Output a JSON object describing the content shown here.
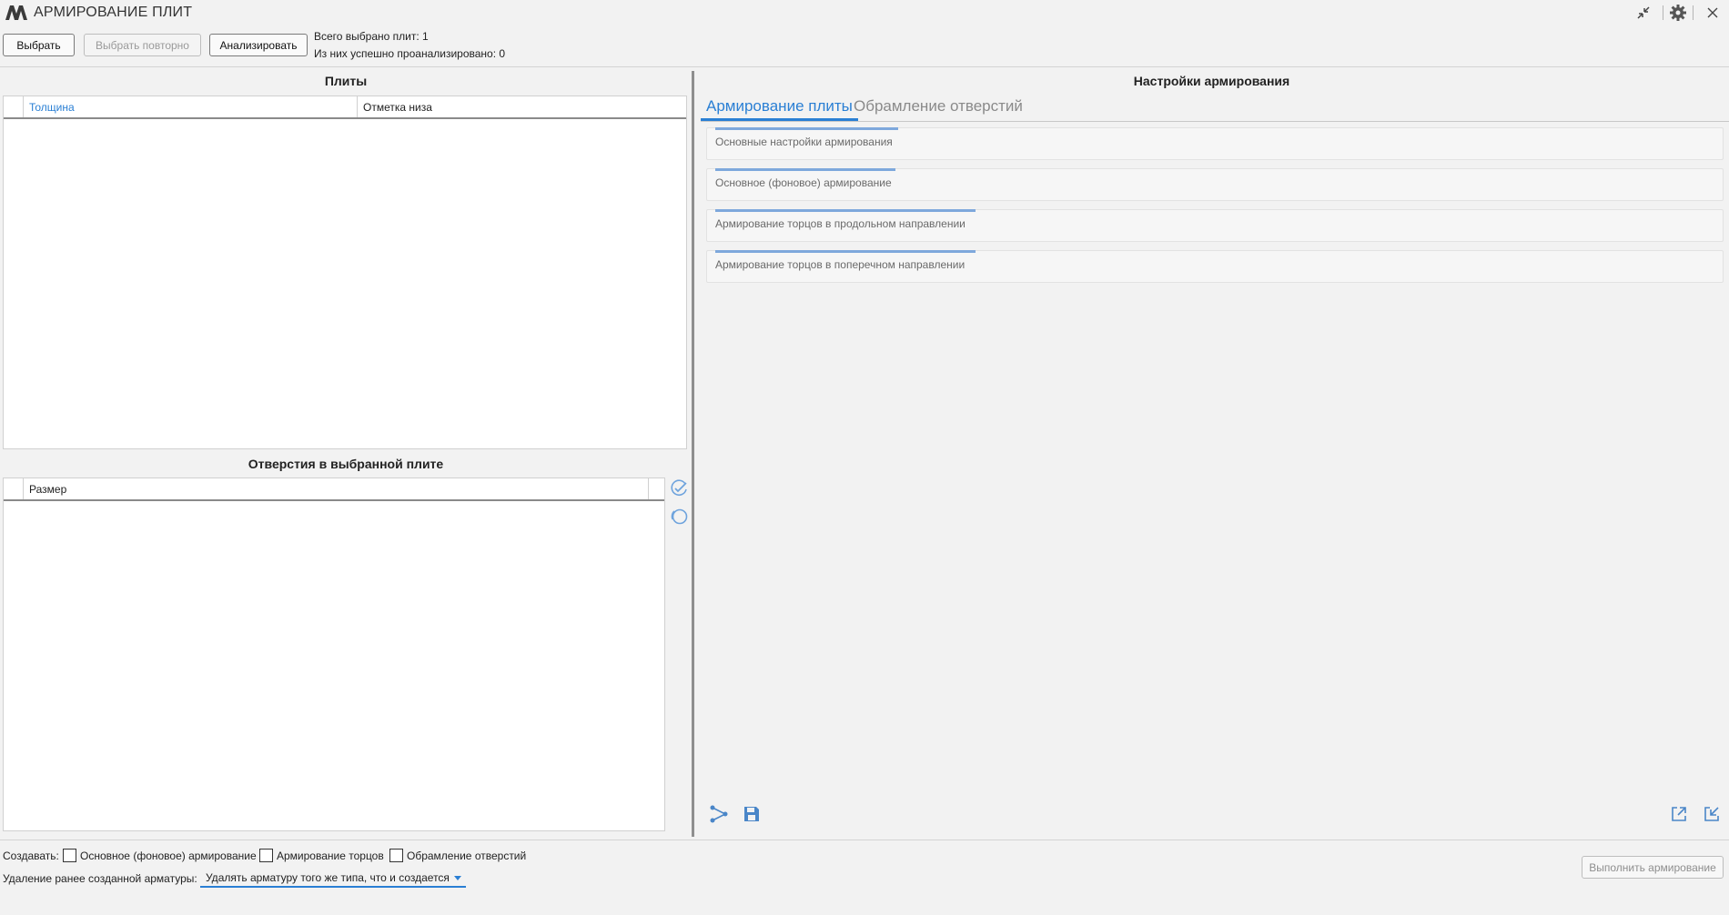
{
  "app": {
    "title": "АРМИРОВАНИЕ ПЛИТ"
  },
  "toolbar": {
    "select_label": "Выбрать",
    "reselect_label": "Выбрать повторно",
    "analyze_label": "Анализировать",
    "total_selected": "Всего выбрано плит: 1",
    "analyzed_ok": "Из них успешно проанализировано: 0"
  },
  "plates": {
    "title": "Плиты",
    "columns": [
      "Толщина",
      "Отметка низа"
    ],
    "rows": []
  },
  "openings": {
    "title": "Отверстия в выбранной плите",
    "columns": [
      "Размер"
    ],
    "rows": []
  },
  "settings": {
    "title": "Настройки армирования",
    "tabs": [
      {
        "label": "Армирование плиты",
        "active": true
      },
      {
        "label": "Обрамление отверстий",
        "active": false
      }
    ],
    "sections": [
      {
        "label": "Основные настройки армирования"
      },
      {
        "label": "Основное (фоновое) армирование"
      },
      {
        "label": "Армирование торцов в продольном направлении"
      },
      {
        "label": "Армирование торцов в поперечном направлении"
      }
    ]
  },
  "bottom": {
    "create_label": "Создавать:",
    "checkboxes": [
      {
        "label": "Основное (фоновое) армирование",
        "checked": false
      },
      {
        "label": "Армирование торцов",
        "checked": false
      },
      {
        "label": "Обрамление отверстий",
        "checked": false
      }
    ],
    "delete_label": "Удаление ранее созданной арматуры:",
    "delete_option": "Удалять арматуру того же типа, что и создается",
    "run_label": "Выполнить армирование"
  },
  "colors": {
    "accent": "#2a7fd4",
    "section_bar": "#7ea8dc",
    "background": "#f2f2f2"
  },
  "icons": [
    "logo-icon",
    "collapse-icon",
    "gear-icon",
    "close-icon",
    "check-all-icon",
    "uncheck-all-icon",
    "share-icon",
    "save-icon",
    "export-icon",
    "import-icon"
  ]
}
